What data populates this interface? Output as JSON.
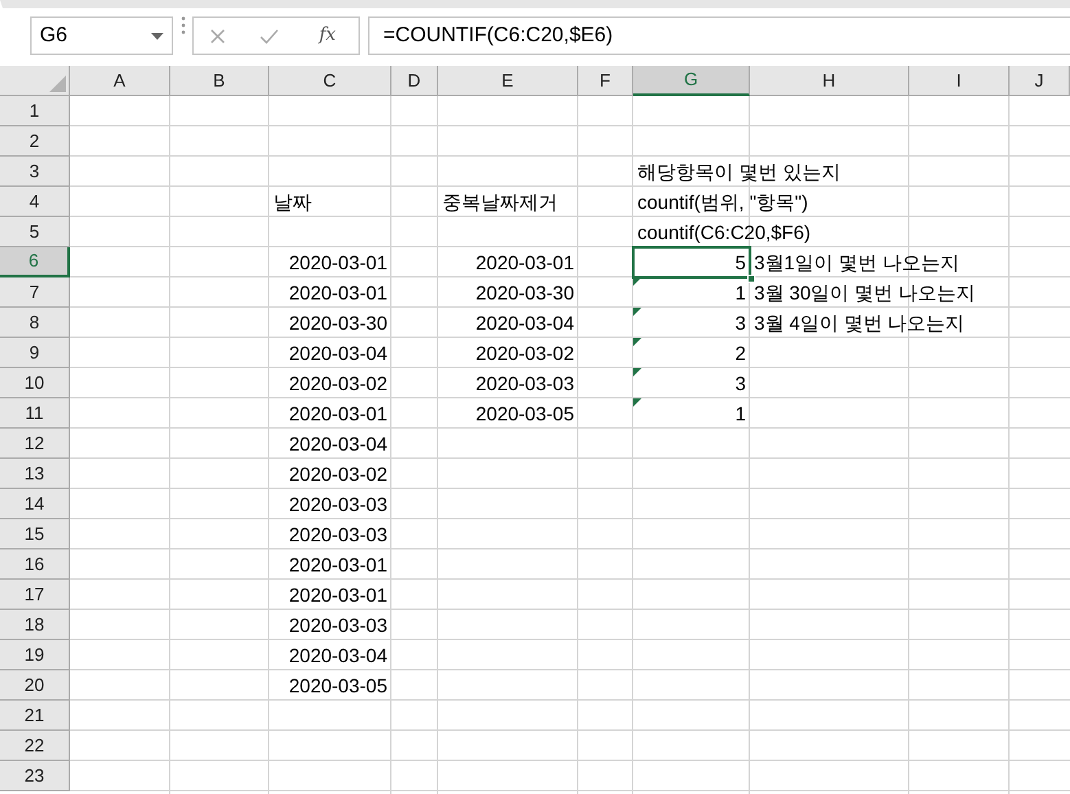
{
  "formula_bar": {
    "name_box": "G6",
    "function_label": "fx",
    "formula": "=COUNTIF(C6:C20,$E6)"
  },
  "columns": [
    {
      "label": "A",
      "selected": false
    },
    {
      "label": "B",
      "selected": false
    },
    {
      "label": "C",
      "selected": false
    },
    {
      "label": "D",
      "selected": false
    },
    {
      "label": "E",
      "selected": false
    },
    {
      "label": "F",
      "selected": false
    },
    {
      "label": "G",
      "selected": true
    },
    {
      "label": "H",
      "selected": false
    },
    {
      "label": "I",
      "selected": false
    },
    {
      "label": "J",
      "selected": false
    }
  ],
  "rows": [
    {
      "label": "1",
      "selected": false
    },
    {
      "label": "2",
      "selected": false
    },
    {
      "label": "3",
      "selected": false,
      "col_g": {
        "kind": "text",
        "text": "해당항목이 몇번 있는지"
      }
    },
    {
      "label": "4",
      "selected": false,
      "col_c": {
        "kind": "text",
        "text": "날짜"
      },
      "col_e": {
        "kind": "text",
        "text": "중복날짜제거"
      },
      "col_g": {
        "kind": "text",
        "text": "countif(범위, \"항목\")"
      }
    },
    {
      "label": "5",
      "selected": false,
      "col_g": {
        "kind": "text",
        "text": "countif(C6:C20,$F6)"
      }
    },
    {
      "label": "6",
      "selected": true,
      "col_c": {
        "kind": "number",
        "text": "2020-03-01"
      },
      "col_e": {
        "kind": "number",
        "text": "2020-03-01"
      },
      "col_g": {
        "kind": "number",
        "text": "5",
        "selected": true,
        "warning": false
      },
      "col_h": {
        "kind": "text",
        "text": "3월1일이 몇번 나오는지"
      }
    },
    {
      "label": "7",
      "selected": false,
      "col_c": {
        "kind": "number",
        "text": "2020-03-01"
      },
      "col_e": {
        "kind": "number",
        "text": "2020-03-30"
      },
      "col_g": {
        "kind": "number",
        "text": "1",
        "selected": false,
        "warning": true
      },
      "col_h": {
        "kind": "text",
        "text": "3월 30일이 몇번 나오는지"
      }
    },
    {
      "label": "8",
      "selected": false,
      "col_c": {
        "kind": "number",
        "text": "2020-03-30"
      },
      "col_e": {
        "kind": "number",
        "text": "2020-03-04"
      },
      "col_g": {
        "kind": "number",
        "text": "3",
        "selected": false,
        "warning": true
      },
      "col_h": {
        "kind": "text",
        "text": "3월 4일이 몇번 나오는지"
      }
    },
    {
      "label": "9",
      "selected": false,
      "col_c": {
        "kind": "number",
        "text": "2020-03-04"
      },
      "col_e": {
        "kind": "number",
        "text": "2020-03-02"
      },
      "col_g": {
        "kind": "number",
        "text": "2",
        "selected": false,
        "warning": true
      }
    },
    {
      "label": "10",
      "selected": false,
      "col_c": {
        "kind": "number",
        "text": "2020-03-02"
      },
      "col_e": {
        "kind": "number",
        "text": "2020-03-03"
      },
      "col_g": {
        "kind": "number",
        "text": "3",
        "selected": false,
        "warning": true
      }
    },
    {
      "label": "11",
      "selected": false,
      "col_c": {
        "kind": "number",
        "text": "2020-03-01"
      },
      "col_e": {
        "kind": "number",
        "text": "2020-03-05"
      },
      "col_g": {
        "kind": "number",
        "text": "1",
        "selected": false,
        "warning": true
      }
    },
    {
      "label": "12",
      "selected": false,
      "col_c": {
        "kind": "number",
        "text": "2020-03-04"
      }
    },
    {
      "label": "13",
      "selected": false,
      "col_c": {
        "kind": "number",
        "text": "2020-03-02"
      }
    },
    {
      "label": "14",
      "selected": false,
      "col_c": {
        "kind": "number",
        "text": "2020-03-03"
      }
    },
    {
      "label": "15",
      "selected": false,
      "col_c": {
        "kind": "number",
        "text": "2020-03-03"
      }
    },
    {
      "label": "16",
      "selected": false,
      "col_c": {
        "kind": "number",
        "text": "2020-03-01"
      }
    },
    {
      "label": "17",
      "selected": false,
      "col_c": {
        "kind": "number",
        "text": "2020-03-01"
      }
    },
    {
      "label": "18",
      "selected": false,
      "col_c": {
        "kind": "number",
        "text": "2020-03-03"
      }
    },
    {
      "label": "19",
      "selected": false,
      "col_c": {
        "kind": "number",
        "text": "2020-03-04"
      }
    },
    {
      "label": "20",
      "selected": false,
      "col_c": {
        "kind": "number",
        "text": "2020-03-05"
      }
    },
    {
      "label": "21",
      "selected": false
    },
    {
      "label": "22",
      "selected": false
    },
    {
      "label": "23",
      "selected": false
    }
  ]
}
